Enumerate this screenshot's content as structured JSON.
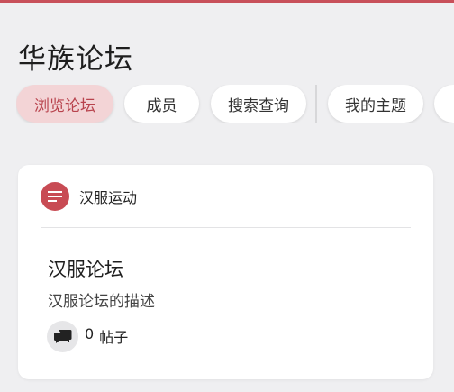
{
  "app": {
    "title": "华族论坛"
  },
  "nav": {
    "items": [
      {
        "label": "浏览论坛",
        "active": true
      },
      {
        "label": "成员",
        "active": false
      },
      {
        "label": "搜索查询",
        "active": false
      },
      {
        "label": "我的主题",
        "active": false
      }
    ]
  },
  "category": {
    "icon": "list-icon",
    "name": "汉服运动",
    "color": "#c84b54"
  },
  "forum": {
    "title": "汉服论坛",
    "description": "汉服论坛的描述",
    "stats_icon": "chat-bubbles-icon",
    "post_count": "0",
    "post_label": "帖子"
  },
  "colors": {
    "accent": "#c8505a",
    "active_tab_bg": "#f3d4d6",
    "active_tab_text": "#b8434d"
  }
}
